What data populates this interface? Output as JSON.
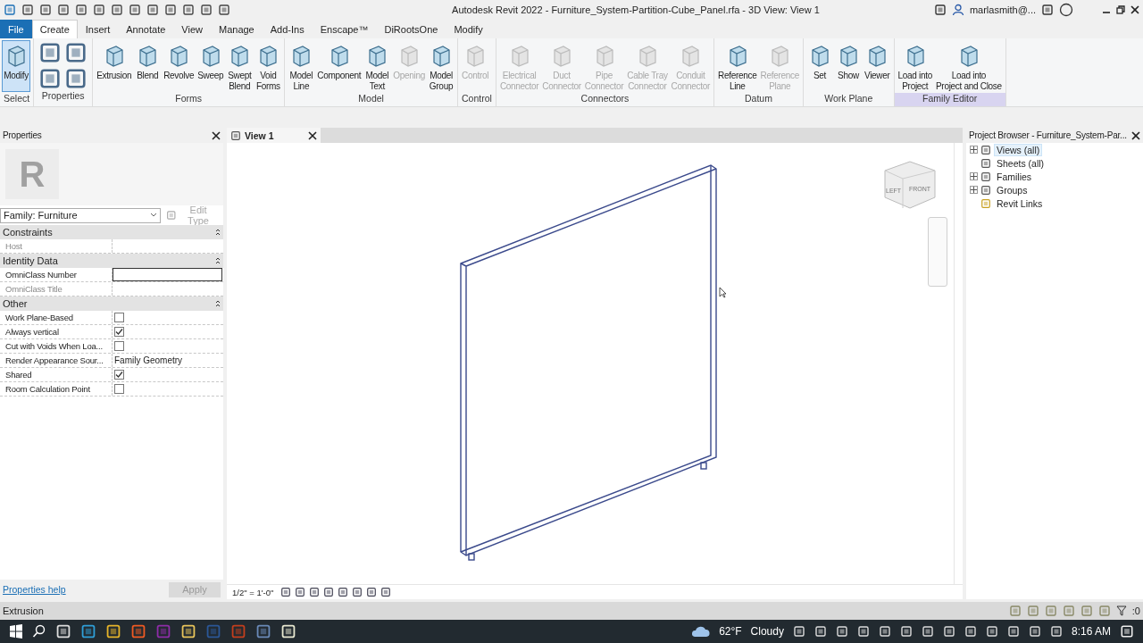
{
  "window": {
    "title": "Autodesk Revit 2022 - Furniture_System-Partition-Cube_Panel.rfa - 3D View: View 1",
    "user": "marlasmith@..."
  },
  "tabs": [
    {
      "label": "File",
      "kind": "file",
      "selected": false
    },
    {
      "label": "Create",
      "kind": "tab",
      "selected": true
    },
    {
      "label": "Insert",
      "kind": "tab",
      "selected": false
    },
    {
      "label": "Annotate",
      "kind": "tab",
      "selected": false
    },
    {
      "label": "View",
      "kind": "tab",
      "selected": false
    },
    {
      "label": "Manage",
      "kind": "tab",
      "selected": false
    },
    {
      "label": "Add-Ins",
      "kind": "tab",
      "selected": false
    },
    {
      "label": "Enscape™",
      "kind": "tab",
      "selected": false
    },
    {
      "label": "DiRootsOne",
      "kind": "tab",
      "selected": false
    },
    {
      "label": "Modify",
      "kind": "tab",
      "selected": false
    }
  ],
  "ribbon": [
    {
      "label": "Select",
      "kind": "tools",
      "highlighted": false,
      "tools": [
        {
          "label": "Modify",
          "disabled": false,
          "selected": true
        }
      ]
    },
    {
      "label": "Properties",
      "kind": "icon_grid",
      "highlighted": false
    },
    {
      "label": "Forms",
      "kind": "tools",
      "highlighted": false,
      "tools": [
        {
          "label": "Extrusion",
          "disabled": false,
          "selected": false
        },
        {
          "label": "Blend",
          "disabled": false,
          "selected": false
        },
        {
          "label": "Revolve",
          "disabled": false,
          "selected": false
        },
        {
          "label": "Sweep",
          "disabled": false,
          "selected": false
        },
        {
          "label": "Swept\nBlend",
          "disabled": false,
          "selected": false
        },
        {
          "label": "Void\nForms",
          "disabled": false,
          "selected": false
        }
      ]
    },
    {
      "label": "Model",
      "kind": "tools",
      "highlighted": false,
      "tools": [
        {
          "label": "Model\nLine",
          "disabled": false,
          "selected": false
        },
        {
          "label": "Component",
          "disabled": false,
          "selected": false
        },
        {
          "label": "Model\nText",
          "disabled": false,
          "selected": false
        },
        {
          "label": "Opening",
          "disabled": true,
          "selected": false
        },
        {
          "label": "Model\nGroup",
          "disabled": false,
          "selected": false
        }
      ]
    },
    {
      "label": "Control",
      "kind": "tools",
      "highlighted": false,
      "tools": [
        {
          "label": "Control",
          "disabled": true,
          "selected": false
        }
      ]
    },
    {
      "label": "Connectors",
      "kind": "tools",
      "highlighted": false,
      "tools": [
        {
          "label": "Electrical\nConnector",
          "disabled": true,
          "selected": false
        },
        {
          "label": "Duct\nConnector",
          "disabled": true,
          "selected": false
        },
        {
          "label": "Pipe\nConnector",
          "disabled": true,
          "selected": false
        },
        {
          "label": "Cable Tray\nConnector",
          "disabled": true,
          "selected": false
        },
        {
          "label": "Conduit\nConnector",
          "disabled": true,
          "selected": false
        }
      ]
    },
    {
      "label": "Datum",
      "kind": "tools",
      "highlighted": false,
      "tools": [
        {
          "label": "Reference\nLine",
          "disabled": false,
          "selected": false
        },
        {
          "label": "Reference\nPlane",
          "disabled": true,
          "selected": false
        }
      ]
    },
    {
      "label": "Work Plane",
      "kind": "tools",
      "highlighted": false,
      "tools": [
        {
          "label": "Set",
          "disabled": false,
          "selected": false
        },
        {
          "label": "Show",
          "disabled": false,
          "selected": false
        },
        {
          "label": "Viewer",
          "disabled": false,
          "selected": false
        }
      ]
    },
    {
      "label": "Family Editor",
      "kind": "tools",
      "highlighted": true,
      "tools": [
        {
          "label": "Load into\nProject",
          "disabled": false,
          "selected": false
        },
        {
          "label": "Load into\nProject and Close",
          "disabled": false,
          "selected": false
        }
      ]
    }
  ],
  "properties": {
    "title": "Properties",
    "preview": "R",
    "type": "Family: Furniture",
    "edit_type": {
      "label": "Edit Type",
      "disabled": true
    },
    "sections": [
      {
        "name": "Constraints",
        "rows": [
          {
            "label": "Host",
            "kind": "text",
            "disabled": true
          }
        ]
      },
      {
        "name": "Identity Data",
        "rows": [
          {
            "label": "OmniClass Number",
            "kind": "field",
            "disabled": false
          },
          {
            "label": "OmniClass Title",
            "kind": "text",
            "disabled": true
          }
        ]
      },
      {
        "name": "Other",
        "rows": [
          {
            "label": "Work Plane-Based",
            "kind": "checkbox",
            "checked": false,
            "disabled": false
          },
          {
            "label": "Always vertical",
            "kind": "checkbox",
            "checked": true,
            "disabled": false
          },
          {
            "label": "Cut with Voids When Loa...",
            "kind": "checkbox",
            "checked": false,
            "disabled": false
          },
          {
            "label": "Render Appearance Sour...",
            "kind": "text",
            "value": "Family Geometry",
            "disabled": false
          },
          {
            "label": "Shared",
            "kind": "checkbox",
            "checked": true,
            "disabled": false
          },
          {
            "label": "Room Calculation Point",
            "kind": "checkbox",
            "checked": false,
            "disabled": false
          }
        ]
      }
    ],
    "help": "Properties help",
    "apply": {
      "label": "Apply",
      "disabled": true
    }
  },
  "view": {
    "tab": "View 1",
    "scale": "1/2\" = 1'-0\"",
    "viewcube": [
      "LEFT",
      "FRONT"
    ]
  },
  "project_browser": {
    "title": "Project Browser - Furniture_System-Par...",
    "items": [
      {
        "label": "Views (all)",
        "kind": "collapsed",
        "selected": true
      },
      {
        "label": "Sheets (all)",
        "kind": "leaf",
        "selected": false
      },
      {
        "label": "Families",
        "kind": "collapsed",
        "selected": false
      },
      {
        "label": "Groups",
        "kind": "collapsed",
        "selected": false
      },
      {
        "label": "Revit Links",
        "kind": "leaf",
        "selected": false
      }
    ]
  },
  "status_bar": {
    "text": "Extrusion",
    "filter_count": ":0"
  },
  "taskbar": {
    "temperature": "62°F",
    "weather": "Cloudy",
    "time": "8:16 AM"
  }
}
